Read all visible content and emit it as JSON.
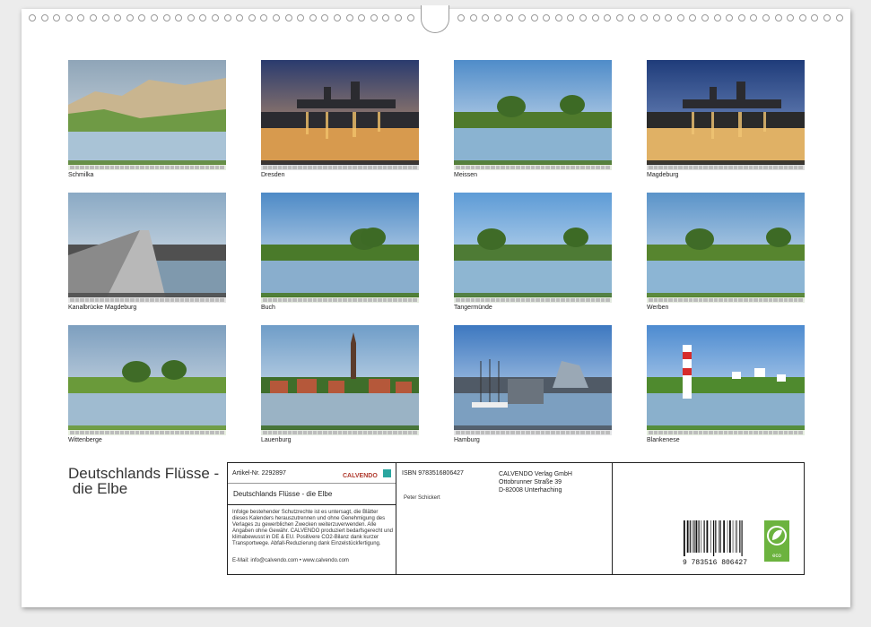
{
  "photos": [
    {
      "caption": "Schmilka",
      "icon": "landscape-photo"
    },
    {
      "caption": "Dresden",
      "icon": "city-night-photo"
    },
    {
      "caption": "Meissen",
      "icon": "river-photo"
    },
    {
      "caption": "Magdeburg",
      "icon": "city-night-photo"
    },
    {
      "caption": "Kanalbrücke Magdeburg",
      "icon": "bridge-photo"
    },
    {
      "caption": "Buch",
      "icon": "river-photo"
    },
    {
      "caption": "Tangermünde",
      "icon": "river-photo"
    },
    {
      "caption": "Werben",
      "icon": "river-photo"
    },
    {
      "caption": "Wittenberge",
      "icon": "river-photo"
    },
    {
      "caption": "Lauenburg",
      "icon": "town-photo"
    },
    {
      "caption": "Hamburg",
      "icon": "harbor-photo"
    },
    {
      "caption": "Blankenese",
      "icon": "lighthouse-photo"
    }
  ],
  "title": "Deutschlands Flüsse -\n die Elbe",
  "info": {
    "article_label": "Artikel-Nr. 2292897",
    "brand": "CALVENDO",
    "calendar_title": "Deutschlands Flüsse - die Elbe",
    "legal_text": "Infolge bestehender Schutzrechte ist es untersagt, die Blätter dieses Kalenders herauszutrennen und ohne Genehmigung des Verlages zu gewerblichen Zwecken weiterzuverwenden. Alle Angaben ohne Gewähr. CALVENDO produziert bedarfsgerecht und klimabewusst in DE & EU. Positivere CO2-Bilanz dank kurzer Transportwege. Abfall-Reduzierung dank Einzelstückfertigung.",
    "contact": "E-Mail: info@calvendo.com • www.calvendo.com",
    "isbn": "ISBN 9783516806427",
    "author": "Peter Schickert",
    "publisher_lines": [
      "CALVENDO Verlag GmbH",
      "Ottobrunner Straße 39",
      "D-82008 Unterhaching"
    ],
    "barcode_number": "9 783516 806427",
    "eco_label": "eco"
  },
  "colors": {
    "eco_green": "#6cb33f",
    "border": "#222222"
  }
}
